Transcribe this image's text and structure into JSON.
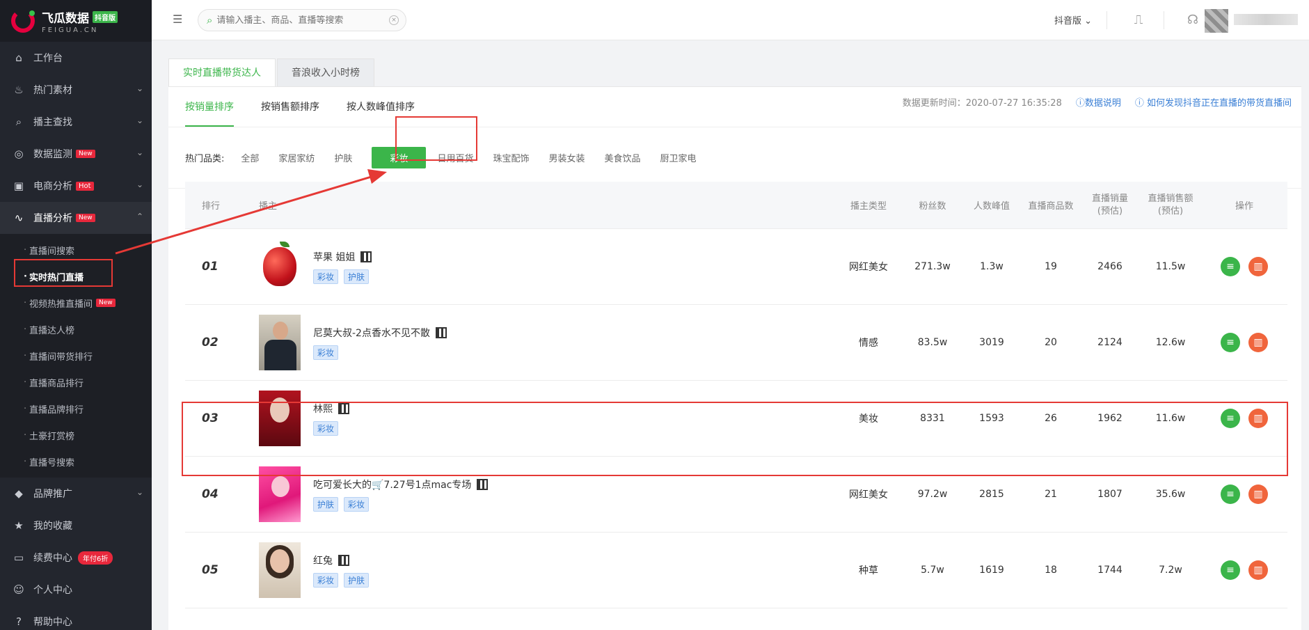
{
  "logo": {
    "cn": "飞瓜数据",
    "badge": "抖音版",
    "en": "FEIGUA.CN"
  },
  "sidebar": {
    "items": [
      {
        "label": "工作台",
        "icon": "home-icon",
        "glyph": "⌂"
      },
      {
        "label": "热门素材",
        "icon": "fire-icon",
        "glyph": "♨",
        "caret": "⌄"
      },
      {
        "label": "播主查找",
        "icon": "search-icon",
        "glyph": "⌕",
        "caret": "⌄"
      },
      {
        "label": "数据监测",
        "icon": "monitor-icon",
        "glyph": "◎",
        "badge": "New",
        "caret": "⌄"
      },
      {
        "label": "电商分析",
        "icon": "shop-icon",
        "glyph": "▣",
        "badge": "Hot",
        "caret": "⌄"
      },
      {
        "label": "直播分析",
        "icon": "live-icon",
        "glyph": "∿",
        "badge": "New",
        "caret": "⌃"
      }
    ],
    "sub_items": [
      "直播间搜索",
      "实时热门直播",
      "视频热推直播间",
      "直播达人榜",
      "直播间带货排行",
      "直播商品排行",
      "直播品牌排行",
      "土豪打赏榜",
      "直播号搜索"
    ],
    "sub_badge": "New",
    "bottom_items": [
      {
        "label": "品牌推广",
        "icon": "diamond-icon",
        "glyph": "◆",
        "caret": "⌄"
      },
      {
        "label": "我的收藏",
        "icon": "star-icon",
        "glyph": "★"
      },
      {
        "label": "续费中心",
        "icon": "card-icon",
        "glyph": "▭",
        "promo": "年付6折"
      },
      {
        "label": "个人中心",
        "icon": "user-icon",
        "glyph": "☺"
      },
      {
        "label": "帮助中心",
        "icon": "help-icon",
        "glyph": "?"
      }
    ]
  },
  "topbar": {
    "toggle_glyph": "☰",
    "search_glyph": "⌕",
    "search_placeholder": "请输入播主、商品、直播等搜索",
    "clear_glyph": "×",
    "version": "抖音版 ⌄",
    "trend_glyph": "⎍",
    "support_glyph": "☊"
  },
  "tabs": [
    "实时直播带货达人",
    "音浪收入小时榜"
  ],
  "sort_tabs": [
    "按销量排序",
    "按销售额排序",
    "按人数峰值排序"
  ],
  "update": {
    "text": "数据更新时间：2020-07-27 16:35:28",
    "link1": "ⓘ数据说明",
    "link2": "ⓘ 如何发现抖音正在直播的带货直播间"
  },
  "categories": {
    "label": "热门品类:",
    "items": [
      "全部",
      "家居家纺",
      "护肤",
      "彩妆",
      "日用百货",
      "珠宝配饰",
      "男装女装",
      "美食饮品",
      "厨卫家电"
    ],
    "active_index": 3
  },
  "table": {
    "headers": {
      "rank": "排行",
      "anchor": "播主",
      "type": "播主类型",
      "fans": "粉丝数",
      "peak": "人数峰值",
      "goods": "直播商品数",
      "vol1": "直播销量",
      "vol2": "(预估)",
      "amt1": "直播销售额",
      "amt2": "(预估)",
      "op": "操作"
    },
    "op_glyphs": {
      "detail": "≡",
      "chart": "▥"
    },
    "rows": [
      {
        "rank": "01",
        "name": "苹果 姐姐",
        "tags": [
          "彩妆",
          "护肤"
        ],
        "type": "网红美女",
        "fans": "271.3w",
        "peak": "1.3w",
        "goods": "19",
        "volume": "2466",
        "amount": "11.5w"
      },
      {
        "rank": "02",
        "name": "尼莫大叔-2点香水不见不散",
        "tags": [
          "彩妆"
        ],
        "type": "情感",
        "fans": "83.5w",
        "peak": "3019",
        "goods": "20",
        "volume": "2124",
        "amount": "12.6w"
      },
      {
        "rank": "03",
        "name": "林熙",
        "tags": [
          "彩妆"
        ],
        "type": "美妆",
        "fans": "8331",
        "peak": "1593",
        "goods": "26",
        "volume": "1962",
        "amount": "11.6w"
      },
      {
        "rank": "04",
        "name": "吃可爱长大的🛒7.27号1点mac专场",
        "tags": [
          "护肤",
          "彩妆"
        ],
        "type": "网红美女",
        "fans": "97.2w",
        "peak": "2815",
        "goods": "21",
        "volume": "1807",
        "amount": "35.6w"
      },
      {
        "rank": "05",
        "name": "红兔",
        "tags": [
          "彩妆",
          "护肤"
        ],
        "type": "种草",
        "fans": "5.7w",
        "peak": "1619",
        "goods": "18",
        "volume": "1744",
        "amount": "7.2w"
      }
    ]
  },
  "colors": {
    "accent": "#3bb54a",
    "highlight": "#e53935",
    "link": "#3a7fd5"
  }
}
